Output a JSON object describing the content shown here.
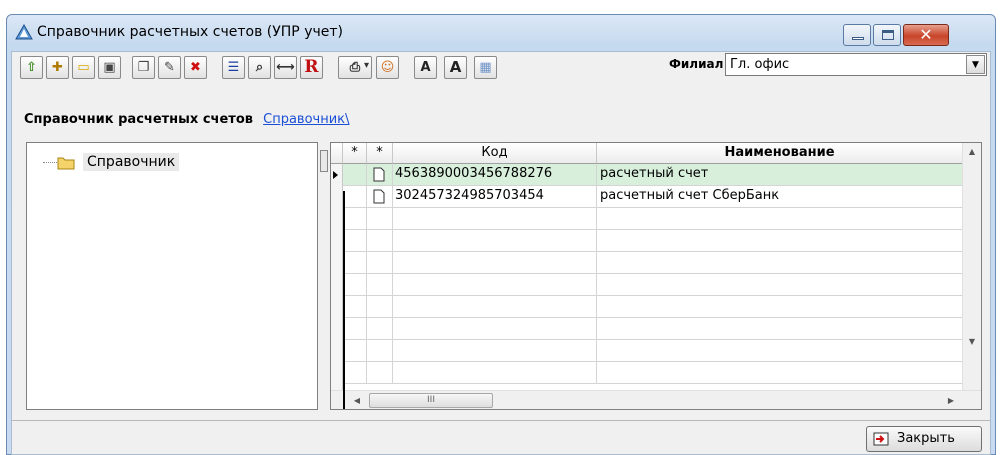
{
  "window": {
    "title": "Справочник расчетных счетов (УПР учет)"
  },
  "toolbar": {
    "buttons": [
      {
        "name": "up-level",
        "icon": "arrow-up-icon",
        "glyph": "⇧",
        "color": "#3a8b1e"
      },
      {
        "name": "new-folder",
        "icon": "new-folder-icon",
        "glyph": "✚",
        "color": "#b07a00"
      },
      {
        "name": "open-folder",
        "icon": "folder-icon",
        "glyph": "▭",
        "color": "#d8a800"
      },
      {
        "name": "copy-folder",
        "icon": "copy-folder-icon",
        "glyph": "▣",
        "color": "#444444"
      },
      {
        "name": "new-record",
        "icon": "new-document-icon",
        "glyph": "❐",
        "color": "#444444"
      },
      {
        "name": "edit-record",
        "icon": "edit-document-icon",
        "glyph": "✎",
        "color": "#444444"
      },
      {
        "name": "delete",
        "icon": "delete-icon",
        "glyph": "✖",
        "color": "#d01010"
      },
      {
        "name": "list-view",
        "icon": "list-icon",
        "glyph": "☰",
        "color": "#1b3fa0"
      },
      {
        "name": "find",
        "icon": "binoculars-icon",
        "glyph": "⌕",
        "color": "#333333"
      },
      {
        "name": "fit-columns",
        "icon": "fit-width-icon",
        "glyph": "⟷",
        "color": "#333333"
      },
      {
        "name": "report",
        "icon": "report-r-icon",
        "glyph": "R",
        "color": "#c01010"
      },
      {
        "name": "print",
        "icon": "printer-icon",
        "glyph": "⎙",
        "color": "#333333"
      },
      {
        "name": "user",
        "icon": "user-icon",
        "glyph": "☺",
        "color": "#d07020"
      },
      {
        "name": "font-increase",
        "icon": "font-increase-icon",
        "glyph": "A",
        "color": "#222222"
      },
      {
        "name": "font-decrease",
        "icon": "font-decrease-icon",
        "glyph": "A",
        "color": "#222222"
      },
      {
        "name": "calendar",
        "icon": "calendar-icon",
        "glyph": "▦",
        "color": "#6f93c8"
      }
    ],
    "filial_label": "Филиал",
    "filial_value": "Гл. офис"
  },
  "breadcrumb": {
    "title": "Справочник расчетных счетов",
    "link": "Справочник\\"
  },
  "tree": {
    "items": [
      {
        "label": "Справочник",
        "icon": "folder-icon"
      }
    ]
  },
  "grid": {
    "columns": [
      "*",
      "*",
      "Код",
      "Наименование"
    ],
    "rows": [
      {
        "code": "4563890003456788276",
        "name": "расчетный счет",
        "selected": true
      },
      {
        "code": "302457324985703454",
        "name": "расчетный счет СберБанк",
        "selected": false
      }
    ],
    "scroll_thumb": "III"
  },
  "footer": {
    "close_label": "Закрыть"
  },
  "colors": {
    "selected_row": "#d8efdc",
    "link": "#1a4fd6",
    "close_button": "#c8452a"
  }
}
